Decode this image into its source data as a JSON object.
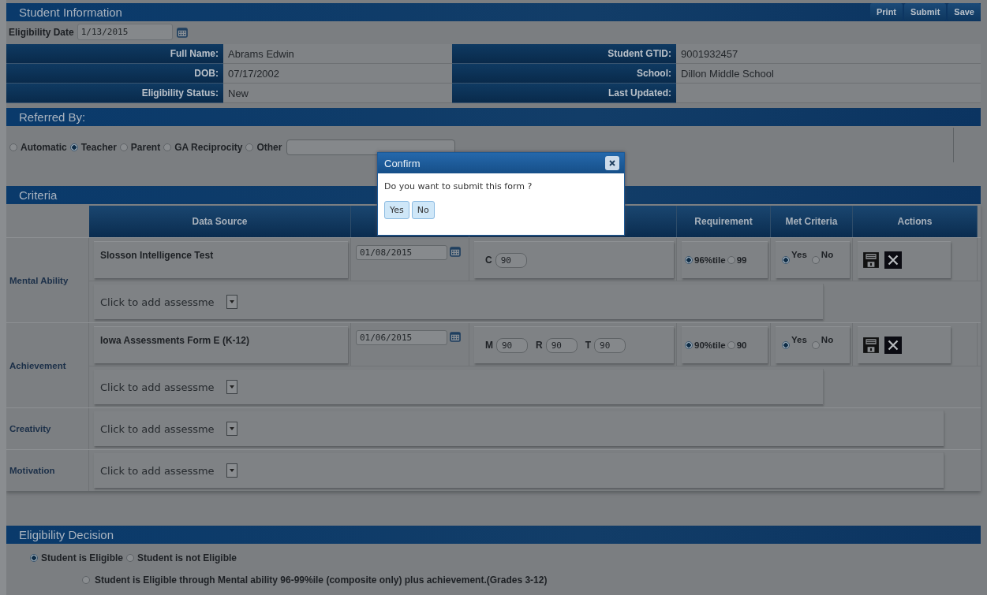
{
  "section_title": "Student Information",
  "toolbar_buttons": [
    "Print",
    "Submit",
    "Save"
  ],
  "eligibility_date": {
    "label": "Eligibility Date",
    "value": "1/13/2015"
  },
  "info_fields": [
    {
      "label": "Full Name:",
      "value": "Abrams Edwin"
    },
    {
      "label": "Student GTID:",
      "value": "9001932457"
    },
    {
      "label": "DOB:",
      "value": "07/17/2002"
    },
    {
      "label": "School:",
      "value": "Dillon Middle School"
    },
    {
      "label": "Eligibility Status:",
      "value": "New"
    },
    {
      "label": "Last Updated:"
    }
  ],
  "referred_by": {
    "title": "Referred By:",
    "options": [
      {
        "label": "Automatic",
        "selected": false
      },
      {
        "label": "Teacher",
        "selected": true
      },
      {
        "label": "Parent",
        "selected": false
      },
      {
        "label": "GA Reciprocity",
        "selected": false
      },
      {
        "label": "Other",
        "selected": false
      }
    ]
  },
  "criteria": {
    "title": "Criteria",
    "columns": [
      "Data Source",
      "Requirement",
      "Met Criteria",
      "Actions"
    ],
    "categories": [
      {
        "name": "Mental Ability",
        "add_select": "Click to add assessme",
        "assessments": [
          {
            "name": "Slosson Intelligence Test",
            "date": "01/08/2015",
            "scores": [
              {
                "label": "C",
                "value": "90"
              }
            ],
            "requirement_options": [
              {
                "label": "96%tile",
                "selected": true
              },
              {
                "label": "99",
                "selected": false
              }
            ],
            "met_criteria": [
              {
                "label": "Yes",
                "selected": true
              },
              {
                "label": "No",
                "selected": false
              }
            ]
          }
        ]
      },
      {
        "name": "Achievement",
        "add_select": "Click to add assessme",
        "assessments": [
          {
            "name": "Iowa Assessments Form E (K-12)",
            "date": "01/06/2015",
            "scores": [
              {
                "label": "M",
                "value": "90"
              },
              {
                "label": "R",
                "value": "90"
              },
              {
                "label": "T",
                "value": "90"
              }
            ],
            "requirement_options": [
              {
                "label": "90%tile",
                "selected": true
              },
              {
                "label": "90",
                "selected": false
              }
            ],
            "met_criteria": [
              {
                "label": "Yes",
                "selected": true
              },
              {
                "label": "No",
                "selected": false
              }
            ]
          }
        ]
      },
      {
        "name": "Creativity",
        "add_select": "Click to add assessme"
      },
      {
        "name": "Motivation",
        "add_select": "Click to add assessme"
      }
    ]
  },
  "eligibility_decision": {
    "title": "Eligibility Decision",
    "options": [
      {
        "label": "Student is Eligible",
        "selected": true
      },
      {
        "label": "Student is not Eligible",
        "selected": false
      }
    ],
    "reasons": [
      {
        "label": "Student is Eligible through Mental ability 96-99%ile (composite only) plus achievement.(Grades 3-12)",
        "selected": false
      }
    ]
  },
  "dialog": {
    "title": "Confirm",
    "message": "Do you want to submit this form ?",
    "buttons": [
      "Yes",
      "No"
    ]
  }
}
